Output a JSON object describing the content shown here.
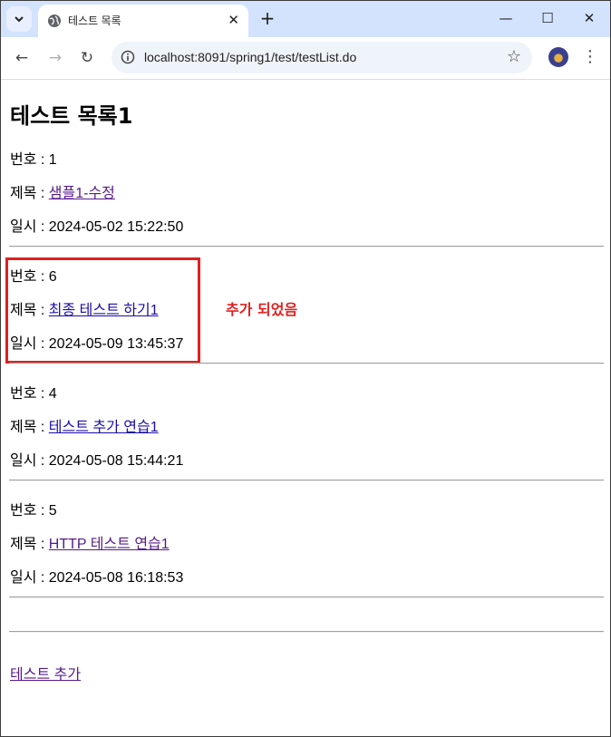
{
  "browser": {
    "tab_title": "테스트 목록",
    "url": "localhost:8091/spring1/test/testList.do",
    "tab_close": "✕",
    "new_tab": "+",
    "minimize": "—",
    "maximize": "☐",
    "close": "✕",
    "back": "←",
    "forward": "→",
    "reload": "↻",
    "star": "☆",
    "menu": "⋮"
  },
  "page": {
    "heading": "테스트 목록1",
    "items": [
      {
        "no_label": "번호 : 1",
        "title_prefix": "제목 : ",
        "title": "샘플1-수정",
        "date_label": "일시 : 2024-05-02 15:22:50"
      },
      {
        "no_label": "번호 : 6",
        "title_prefix": "제목 : ",
        "title": "최종 테스트 하기1",
        "date_label": "일시 : 2024-05-09 13:45:37"
      },
      {
        "no_label": "번호 : 4",
        "title_prefix": "제목 : ",
        "title": "테스트 추가 연습1",
        "date_label": "일시 : 2024-05-08 15:44:21"
      },
      {
        "no_label": "번호 : 5",
        "title_prefix": "제목 : ",
        "title": "HTTP 테스트 연습1",
        "date_label": "일시 : 2024-05-08 16:18:53"
      }
    ],
    "annotation": "추가 되었음",
    "add_link": "테스트 추가"
  },
  "colors": {
    "annotation": "#e02020",
    "link": "#1a0dab",
    "visited": "#551a8b",
    "tabstrip": "#d3e3fd"
  }
}
